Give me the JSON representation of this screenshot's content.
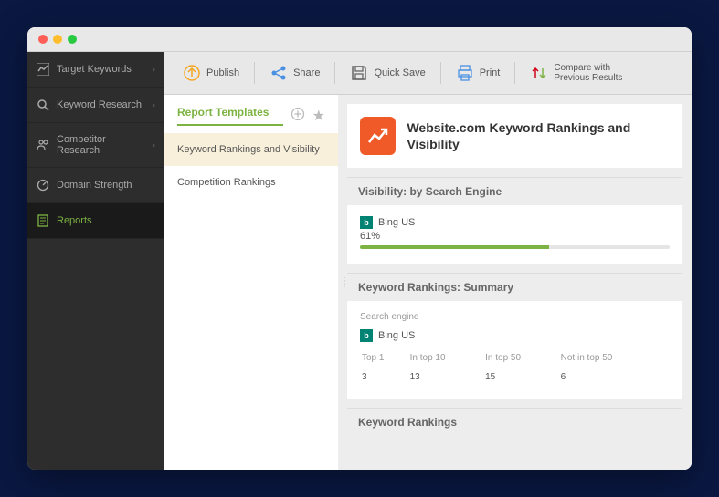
{
  "sidebar": {
    "items": [
      {
        "label": "Target Keywords",
        "expandable": true
      },
      {
        "label": "Keyword Research",
        "expandable": true
      },
      {
        "label": "Competitor Research",
        "expandable": true
      },
      {
        "label": "Domain Strength",
        "expandable": false
      },
      {
        "label": "Reports",
        "expandable": false,
        "active": true
      }
    ]
  },
  "toolbar": {
    "publish": "Publish",
    "share": "Share",
    "quicksave": "Quick Save",
    "print": "Print",
    "compare_line1": "Compare with",
    "compare_line2": "Previous Results"
  },
  "templates": {
    "title": "Report Templates",
    "items": [
      {
        "label": "Keyword Rankings and Visibility",
        "selected": true
      },
      {
        "label": "Competition Rankings",
        "selected": false
      }
    ]
  },
  "report": {
    "title": "Website.com Keyword Rankings and Visibility",
    "sections": {
      "visibility": {
        "title": "Visibility: by Search Engine",
        "engine": "Bing US",
        "pct_label": "61%",
        "pct_value": 61
      },
      "summary": {
        "title": "Keyword Rankings: Summary",
        "sub": "Search engine",
        "engine": "Bing US",
        "columns": [
          "Top 1",
          "In top 10",
          "In top 50",
          "Not in top 50"
        ],
        "values": [
          "3",
          "13",
          "15",
          "6"
        ]
      },
      "rankings": {
        "title": "Keyword Rankings"
      }
    }
  }
}
